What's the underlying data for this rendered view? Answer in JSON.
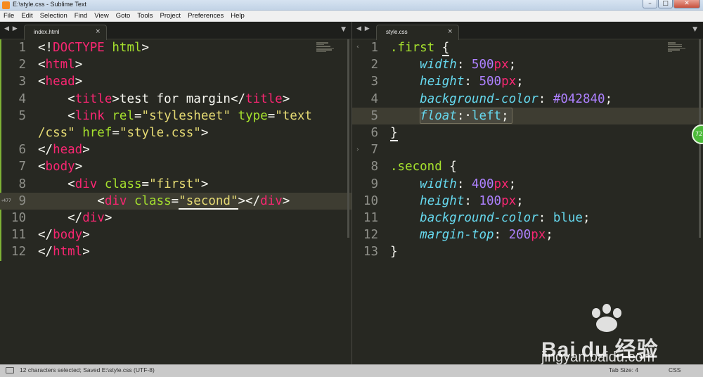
{
  "window": {
    "title": "E:\\style.css - Sublime Text",
    "controls": [
      "–",
      "□",
      "✕"
    ]
  },
  "menu": [
    "File",
    "Edit",
    "Selection",
    "Find",
    "View",
    "Goto",
    "Tools",
    "Project",
    "Preferences",
    "Help"
  ],
  "tab_nav": "◀ ▶",
  "tab_dropdown": "▼",
  "left_pane": {
    "tab": {
      "label": "index.html",
      "close": "×"
    },
    "line_numbers": [
      "1",
      "2",
      "3",
      "4",
      "5",
      "",
      "6",
      "7",
      "8",
      "9",
      "10",
      "11",
      "12"
    ]
  },
  "right_pane": {
    "tab": {
      "label": "style.css",
      "close": "×"
    },
    "line_numbers": [
      "1",
      "2",
      "3",
      "4",
      "5",
      "6",
      "7",
      "8",
      "9",
      "10",
      "11",
      "12",
      "13"
    ]
  },
  "badge": "72",
  "watermark": {
    "logo_text": "Bai du 经验",
    "url": "jingyan.baidu.com"
  },
  "status": {
    "message": "12 characters selected; Saved E:\\style.css (UTF-8)",
    "tab_size": "Tab Size: 4",
    "syntax": "CSS"
  },
  "colors": {
    "background": "#272822",
    "tag": "#f92672",
    "attribute": "#a6e22e",
    "string": "#e6db74",
    "property": "#66d9ef",
    "number": "#ae81ff"
  }
}
